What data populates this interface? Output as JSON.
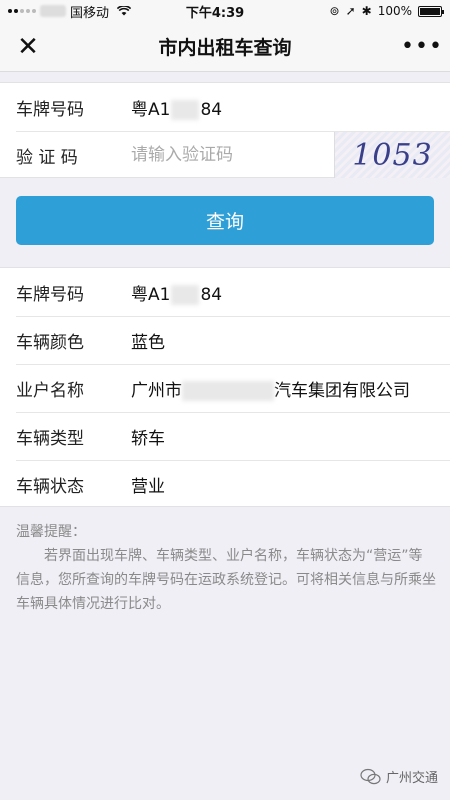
{
  "status_bar": {
    "carrier": "国移动",
    "time": "下午4:39",
    "battery": "100%"
  },
  "nav": {
    "title": "市内出租车查询",
    "close_icon": "close-icon",
    "more_icon": "more-icon"
  },
  "form": {
    "plate_label": "车牌号码",
    "plate_prefix": "粤A1",
    "plate_suffix": "84",
    "captcha_label": "验 证 码",
    "captcha_placeholder": "请输入验证码",
    "captcha_code": "1053"
  },
  "query_button": "查询",
  "result": {
    "rows": [
      {
        "label": "车牌号码",
        "value_prefix": "粤A1",
        "value_suffix": "84"
      },
      {
        "label": "车辆颜色",
        "value": "蓝色"
      },
      {
        "label": "业户名称",
        "value_prefix": "广州市",
        "value_suffix": "汽车集团有限公司"
      },
      {
        "label": "车辆类型",
        "value": "轿车"
      },
      {
        "label": "车辆状态",
        "value": "营业"
      }
    ]
  },
  "tips": {
    "title": "温馨提醒：",
    "body": "若界面出现车牌、车辆类型、业户名称，车辆状态为“营运”等信息，您所查询的车牌号码在运政系统登记。可将相关信息与所乘坐车辆具体情况进行比对。"
  },
  "watermark": "广州交通",
  "colors": {
    "accent": "#2f9fd7",
    "background": "#f0eff5"
  }
}
